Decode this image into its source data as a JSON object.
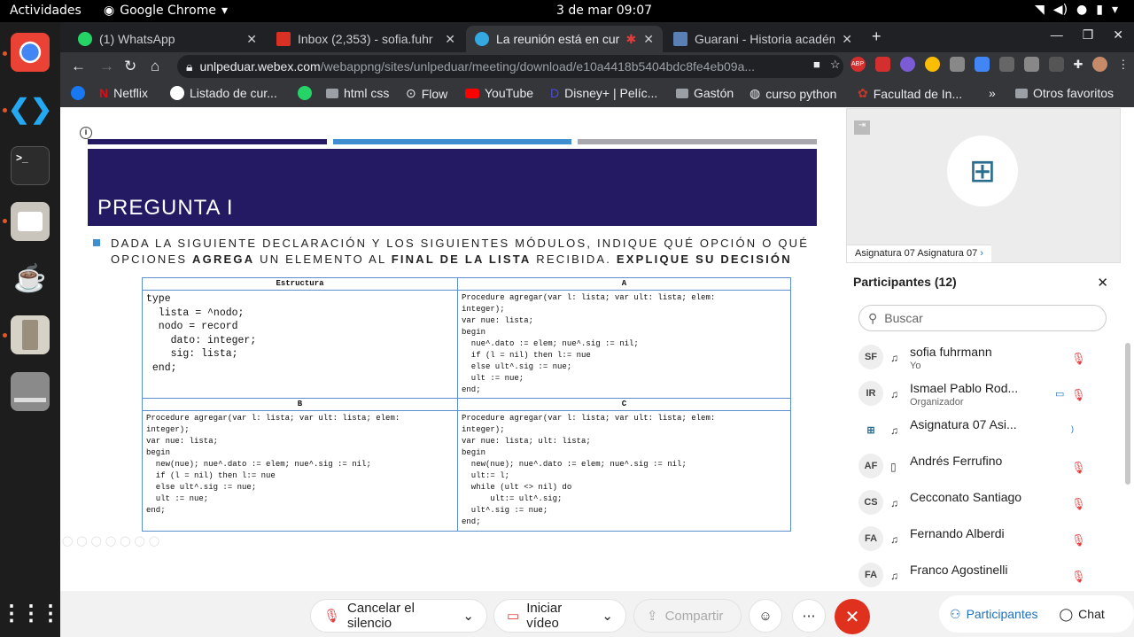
{
  "topbar": {
    "activities": "Actividades",
    "app": "Google Chrome",
    "clock": "3 de mar  09:07"
  },
  "tabs": [
    {
      "title": "(1) WhatsApp",
      "color": "#25d366"
    },
    {
      "title": "Inbox (2,353) - sofia.fuhr",
      "color": "#d93025"
    },
    {
      "title": "La reunión está en curso",
      "color": "#34a8e0"
    },
    {
      "title": "Guarani - Historia académica",
      "color": "#5a7fb5"
    }
  ],
  "address": {
    "host": "unlpeduar.webex.com",
    "path": "/webappng/sites/unlpeduar/meeting/download/e10a4418b5404bdc8fe4eb09a..."
  },
  "extensions": {
    "abp": "ABP"
  },
  "bookmarks": [
    "Netflix",
    "Listado de cur...",
    "",
    "html css",
    "Flow",
    "YouTube",
    "Disney+ | Pelíc...",
    "Gastón",
    "curso python",
    "Facultad de In...",
    "Otros favoritos"
  ],
  "slide": {
    "title": "PREGUNTA I",
    "question": {
      "p1": "DADA LA SIGUIENTE DECLARACIÓN Y LOS SIGUIENTES MÓDULOS, INDIQUE QUÉ OPCIÓN O QUÉ OPCIONES ",
      "b1": "AGREGA",
      "p2": " UN ELEMENTO AL ",
      "b2": "FINAL DE LA LISTA",
      "p3": " RECIBIDA. ",
      "b3": "EXPLIQUE SU DECISIÓN"
    },
    "headers": {
      "estructura": "Estructura",
      "a": "A",
      "b": "B",
      "c": "C"
    },
    "estructura": "type\n  lista = ^nodo;\n  nodo = record\n    dato: integer;\n    sig: lista;\n end;",
    "a": "Procedure agregar(var l: lista; var ult: lista; elem:\ninteger);\nvar nue: lista;\nbegin\n  nue^.dato := elem; nue^.sig := nil;\n  if (l = nil) then l:= nue\n  else ult^.sig := nue;\n  ult := nue;\nend;",
    "b": "Procedure agregar(var l: lista; var ult: lista; elem:\ninteger);\nvar nue: lista;\nbegin\n  new(nue); nue^.dato := elem; nue^.sig := nil;\n  if (l = nil) then l:= nue\n  else ult^.sig := nue;\n  ult := nue;\nend;",
    "c": "Procedure agregar(var l: lista; var ult: lista; elem:\ninteger);\nvar nue: lista; ult: lista;\nbegin\n  new(nue); nue^.dato := elem; nue^.sig := nil;\n  ult:= l;\n  while (ult <> nil) do\n      ult:= ult^.sig;\n  ult^.sig := nue;\nend;"
  },
  "video": {
    "name": "Asignatura 07 Asignatura 07"
  },
  "participants": {
    "title": "Participantes (12)",
    "search_placeholder": "Buscar",
    "list": [
      {
        "initials": "SF",
        "name": "sofia fuhrmann",
        "role": "Yo"
      },
      {
        "initials": "IR",
        "name": "Ismael Pablo Rod...",
        "role": "Organizador"
      },
      {
        "initials": "",
        "name": "Asignatura 07 Asi...",
        "role": ""
      },
      {
        "initials": "AF",
        "name": "Andrés Ferrufino",
        "role": ""
      },
      {
        "initials": "CS",
        "name": "Cecconato Santiago",
        "role": ""
      },
      {
        "initials": "FA",
        "name": "Fernando Alberdi",
        "role": ""
      },
      {
        "initials": "FA",
        "name": "Franco Agostinelli",
        "role": ""
      }
    ]
  },
  "controls": {
    "mute": "Cancelar el silencio",
    "video": "Iniciar vídeo",
    "share": "Compartir",
    "participants": "Participantes",
    "chat": "Chat"
  }
}
